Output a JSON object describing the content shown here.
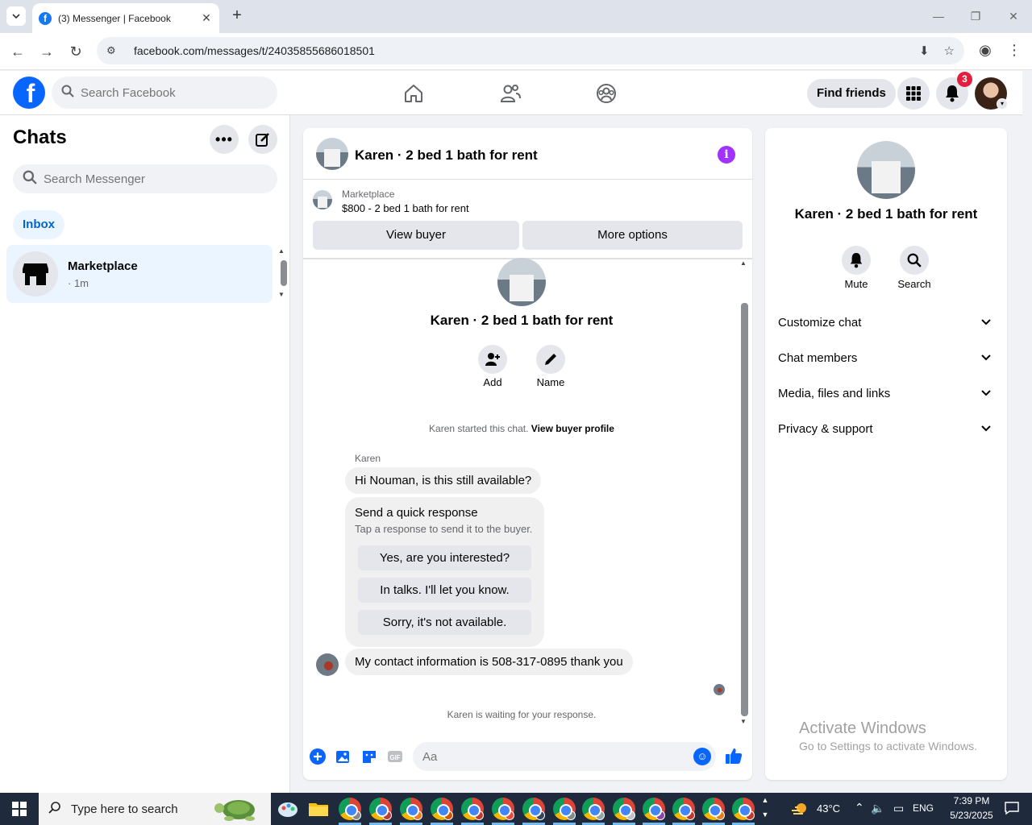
{
  "browser": {
    "tab_title": "(3) Messenger | Facebook",
    "url": "facebook.com/messages/t/24035855686018501"
  },
  "topbar": {
    "search_placeholder": "Search Facebook",
    "find_friends": "Find friends",
    "notification_count": "3"
  },
  "left": {
    "title": "Chats",
    "search_placeholder": "Search Messenger",
    "inbox_label": "Inbox",
    "chats": [
      {
        "name": "Marketplace",
        "time": "· 1m"
      }
    ]
  },
  "conversation": {
    "title": "Karen · 2 bed 1 bath for rent",
    "marketplace_label": "Marketplace",
    "listing": "$800 - 2 bed 1 bath for rent",
    "view_buyer": "View buyer",
    "more_options": "More options",
    "thread_name": "Karen · 2 bed 1 bath for rent",
    "actions": [
      {
        "label": "Add",
        "icon": "add-person-icon"
      },
      {
        "label": "Name",
        "icon": "pencil-icon"
      }
    ],
    "started_text": "Karen started this chat.",
    "view_buyer_profile": "View buyer profile",
    "sender": "Karen",
    "messages": [
      "Hi Nouman, is this still available?",
      "My contact information is 508-317-0895 thank you"
    ],
    "quick_response": {
      "title": "Send a quick response",
      "subtitle": "Tap a response to send it to the buyer.",
      "options": [
        "Yes, are you interested?",
        "In talks. I'll let you know.",
        "Sorry, it's not available."
      ]
    },
    "waiting_text": "Karen is waiting for your response.",
    "composer_placeholder": "Aa"
  },
  "right_panel": {
    "name": "Karen · 2 bed 1 bath for rent",
    "actions": [
      {
        "label": "Mute",
        "icon": "bell-icon"
      },
      {
        "label": "Search",
        "icon": "search-icon"
      }
    ],
    "sections": [
      "Customize chat",
      "Chat members",
      "Media, files and links",
      "Privacy & support"
    ],
    "watermark_title": "Activate Windows",
    "watermark_sub": "Go to Settings to activate Windows."
  },
  "taskbar": {
    "search_text": "Type here to search",
    "temperature": "43°C",
    "language": "ENG",
    "time": "7:39 PM",
    "date": "5/23/2025"
  },
  "colors": {
    "fb_blue": "#0866ff",
    "accent_purple": "#a033ff",
    "badge_red": "#e41e3f"
  }
}
